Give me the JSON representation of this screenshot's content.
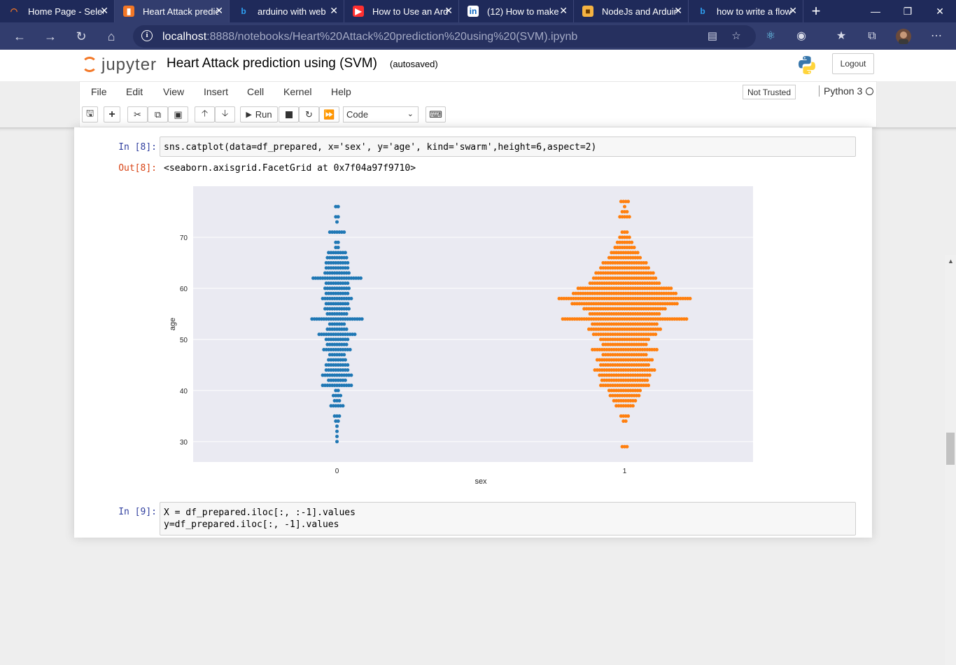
{
  "browser": {
    "tabs": [
      {
        "title": "Home Page - Select",
        "icon": "loading-icon",
        "active": false
      },
      {
        "title": "Heart Attack prediction",
        "icon": "notebook-icon",
        "active": true
      },
      {
        "title": "arduino with web",
        "icon": "bing-icon",
        "active": false
      },
      {
        "title": "How to Use an Arduino",
        "icon": "youtube-icon",
        "active": false
      },
      {
        "title": "(12) How to make",
        "icon": "linkedin-icon",
        "active": false
      },
      {
        "title": "NodeJs and Arduino",
        "icon": "site-icon",
        "active": false
      },
      {
        "title": "how to write a flow",
        "icon": "bing-icon",
        "active": false
      }
    ],
    "url_host": "localhost",
    "url_rest": ":8888/notebooks/Heart%20Attack%20prediction%20using%20(SVM).ipynb"
  },
  "jupyter": {
    "logo_text": "jupyter",
    "notebook_title": "Heart Attack prediction using (SVM)",
    "autosave": "(autosaved)",
    "logout_label": "Logout",
    "menu": [
      "File",
      "Edit",
      "View",
      "Insert",
      "Cell",
      "Kernel",
      "Help"
    ],
    "trust_label": "Not Trusted",
    "kernel_name": "Python 3",
    "run_label": "Run",
    "cell_type": "Code"
  },
  "cells": {
    "c8_prompt_in": "In [8]:",
    "c8_prompt_out": "Out[8]:",
    "c8_output": "<seaborn.axisgrid.FacetGrid at 0x7f04a97f9710>",
    "c9_prompt_in": "In [9]:"
  },
  "chart_data": {
    "type": "scatter",
    "subtype": "swarm",
    "categories": [
      "0",
      "1"
    ],
    "xlabel": "sex",
    "ylabel": "age",
    "ylim": [
      26,
      80
    ],
    "yticks": [
      30,
      40,
      50,
      60,
      70
    ],
    "grid": true,
    "colors": {
      "0": "#1f77b4",
      "1": "#ff7f0e",
      "background": "#eaeaf2"
    },
    "series": [
      {
        "category": "0",
        "age_counts": [
          [
            30,
            1
          ],
          [
            31,
            1
          ],
          [
            32,
            1
          ],
          [
            33,
            1
          ],
          [
            34,
            2
          ],
          [
            35,
            3
          ],
          [
            37,
            6
          ],
          [
            38,
            3
          ],
          [
            39,
            4
          ],
          [
            40,
            2
          ],
          [
            41,
            13
          ],
          [
            42,
            8
          ],
          [
            43,
            13
          ],
          [
            44,
            10
          ],
          [
            45,
            10
          ],
          [
            46,
            8
          ],
          [
            47,
            7
          ],
          [
            48,
            12
          ],
          [
            49,
            9
          ],
          [
            50,
            10
          ],
          [
            51,
            16
          ],
          [
            52,
            9
          ],
          [
            53,
            7
          ],
          [
            54,
            22
          ],
          [
            55,
            9
          ],
          [
            56,
            11
          ],
          [
            57,
            10
          ],
          [
            58,
            13
          ],
          [
            59,
            10
          ],
          [
            60,
            11
          ],
          [
            61,
            10
          ],
          [
            62,
            21
          ],
          [
            63,
            11
          ],
          [
            64,
            10
          ],
          [
            65,
            10
          ],
          [
            66,
            9
          ],
          [
            67,
            8
          ],
          [
            68,
            2
          ],
          [
            69,
            2
          ],
          [
            71,
            7
          ],
          [
            73,
            1
          ],
          [
            74,
            2
          ],
          [
            76,
            2
          ]
        ]
      },
      {
        "category": "1",
        "age_counts": [
          [
            29,
            3
          ],
          [
            34,
            2
          ],
          [
            35,
            4
          ],
          [
            37,
            8
          ],
          [
            38,
            10
          ],
          [
            39,
            13
          ],
          [
            40,
            14
          ],
          [
            41,
            21
          ],
          [
            42,
            20
          ],
          [
            43,
            22
          ],
          [
            44,
            26
          ],
          [
            45,
            21
          ],
          [
            46,
            24
          ],
          [
            47,
            19
          ],
          [
            48,
            28
          ],
          [
            49,
            19
          ],
          [
            50,
            21
          ],
          [
            51,
            27
          ],
          [
            52,
            31
          ],
          [
            53,
            28
          ],
          [
            54,
            53
          ],
          [
            55,
            30
          ],
          [
            56,
            35
          ],
          [
            57,
            45
          ],
          [
            58,
            56
          ],
          [
            59,
            44
          ],
          [
            60,
            40
          ],
          [
            61,
            30
          ],
          [
            62,
            27
          ],
          [
            63,
            25
          ],
          [
            64,
            21
          ],
          [
            65,
            19
          ],
          [
            66,
            14
          ],
          [
            67,
            12
          ],
          [
            68,
            9
          ],
          [
            69,
            7
          ],
          [
            70,
            5
          ],
          [
            71,
            3
          ],
          [
            74,
            5
          ],
          [
            75,
            3
          ],
          [
            76,
            1
          ],
          [
            77,
            4
          ]
        ]
      }
    ]
  },
  "code": {
    "c8": "sns.catplot(data=df_prepared, x='sex', y='age', kind='swarm',height=6,aspect=2)",
    "c9_line1": "X = df_prepared.iloc[:, :-1].values",
    "c9_line2": "y=df_prepared.iloc[:, -1].values"
  }
}
